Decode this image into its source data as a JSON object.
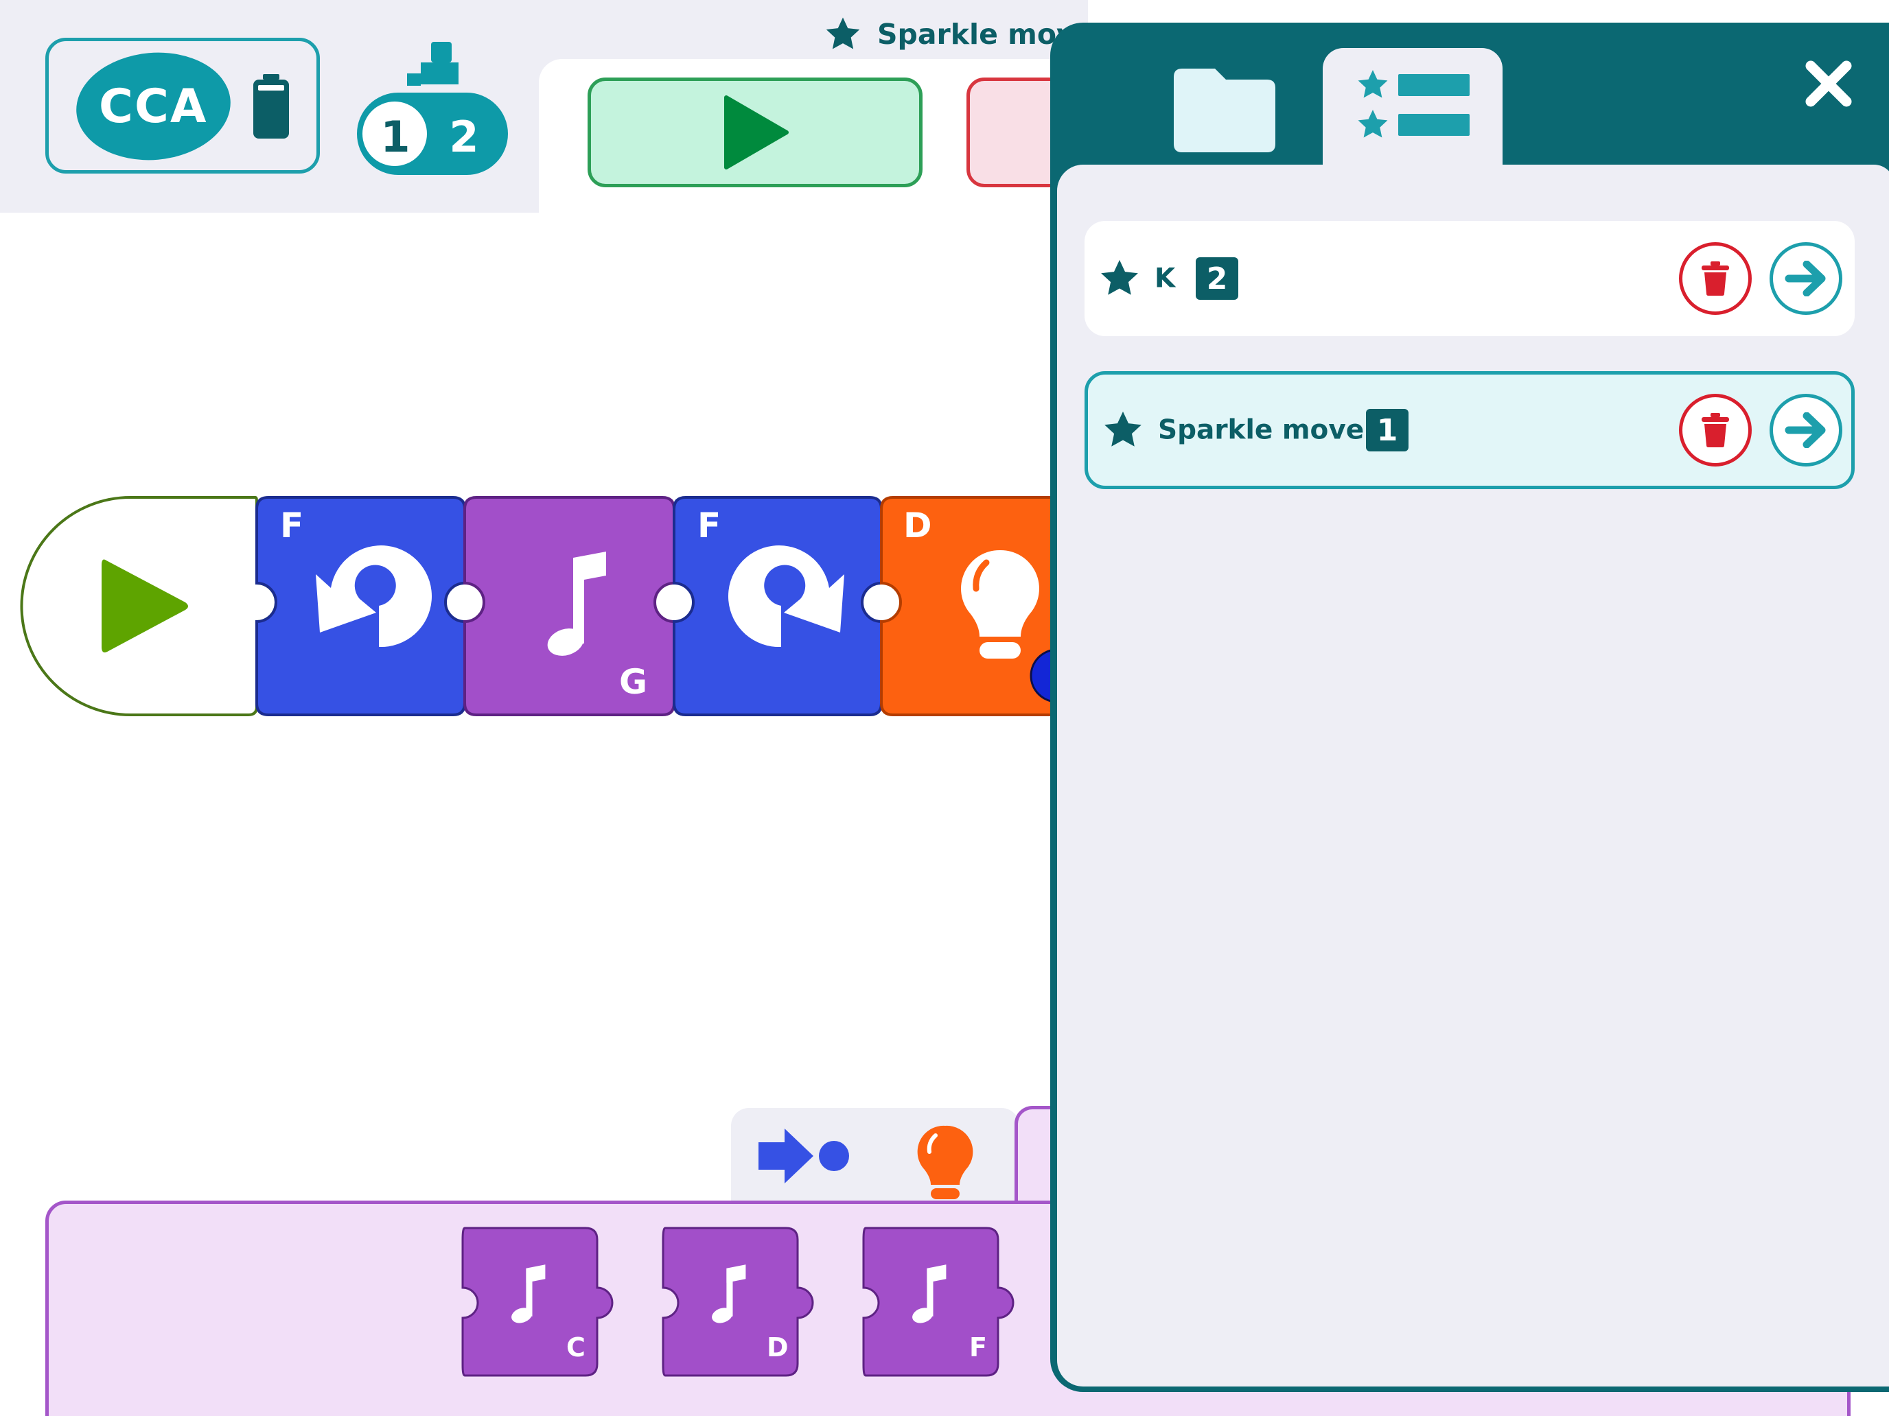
{
  "robot": {
    "name": "CCA",
    "battery_icon": "battery-icon"
  },
  "level": {
    "options": [
      "1",
      "2"
    ],
    "icon": "stairs-icon"
  },
  "header": {
    "current_program": "Sparkle move",
    "star_icon": "star-icon"
  },
  "controls": {
    "play_icon": "play-icon",
    "stop_icon": "stop-icon"
  },
  "program_blocks": [
    {
      "type": "start",
      "icon": "play-icon"
    },
    {
      "type": "turn-left",
      "port": "F",
      "icon": "rotate-left-icon"
    },
    {
      "type": "sound",
      "note": "G",
      "icon": "music-note-icon"
    },
    {
      "type": "turn-right",
      "port": "F",
      "icon": "rotate-right-icon"
    },
    {
      "type": "light",
      "port": "D",
      "icon": "lightbulb-icon"
    }
  ],
  "palette": {
    "tabs": [
      {
        "icon": "motion-icon"
      },
      {
        "icon": "lightbulb-icon"
      }
    ],
    "blocks": [
      {
        "note": "C",
        "icon": "music-note-icon"
      },
      {
        "note": "D",
        "icon": "music-note-icon"
      },
      {
        "note": "F",
        "icon": "music-note-icon"
      }
    ]
  },
  "panel": {
    "tabs": [
      {
        "icon": "folder-icon"
      },
      {
        "icon": "favorites-list-icon"
      }
    ],
    "close_icon": "close-icon",
    "items": [
      {
        "name": "K",
        "count": "2",
        "selected": false
      },
      {
        "name": "Sparkle move",
        "count": "1",
        "selected": true
      }
    ]
  },
  "colors": {
    "teal": "#0b6872",
    "accent": "#1d9fac",
    "motion_blue": "#3651e4",
    "sound_purple": "#a24fc9",
    "light_orange": "#fd6110",
    "start_green": "#5ea400",
    "delete_red": "#d91f2d"
  }
}
